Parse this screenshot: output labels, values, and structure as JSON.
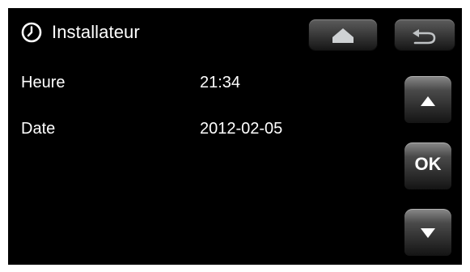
{
  "header": {
    "title": "Installateur",
    "icon": "clock-icon"
  },
  "rows": [
    {
      "label": "Heure",
      "value": "21:34"
    },
    {
      "label": "Date",
      "value": "2012-02-05"
    }
  ],
  "buttons": {
    "home_icon": "home-icon",
    "back_icon": "back-arrow-icon",
    "up_icon": "arrow-up-icon",
    "ok_label": "OK",
    "down_icon": "arrow-down-icon"
  },
  "colors": {
    "background": "#000000",
    "text": "#ffffff"
  }
}
